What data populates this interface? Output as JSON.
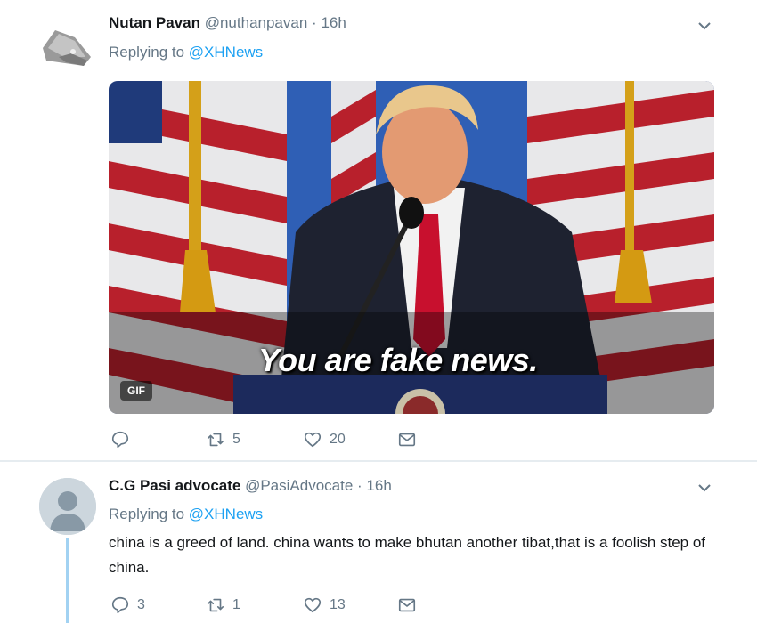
{
  "tweets": [
    {
      "name": "Nutan Pavan",
      "handle": "@nuthanpavan",
      "dot": "·",
      "time": "16h",
      "replying_prefix": "Replying to",
      "replying_to": "@XHNews",
      "media": {
        "type": "gif",
        "badge": "GIF",
        "caption": "You are fake news."
      },
      "actions": {
        "reply": "",
        "retweet": "5",
        "like": "20"
      }
    },
    {
      "name": "C.G Pasi advocate",
      "handle": "@PasiAdvocate",
      "dot": "·",
      "time": "16h",
      "replying_prefix": "Replying to",
      "replying_to": "@XHNews",
      "text": "china is a greed of land. china wants to make bhutan another tibat,that is a foolish step of china.",
      "actions": {
        "reply": "3",
        "retweet": "1",
        "like": "13"
      }
    }
  ],
  "colors": {
    "link": "#1da1f2",
    "muted": "#657786",
    "thread": "#a2d2f2"
  }
}
